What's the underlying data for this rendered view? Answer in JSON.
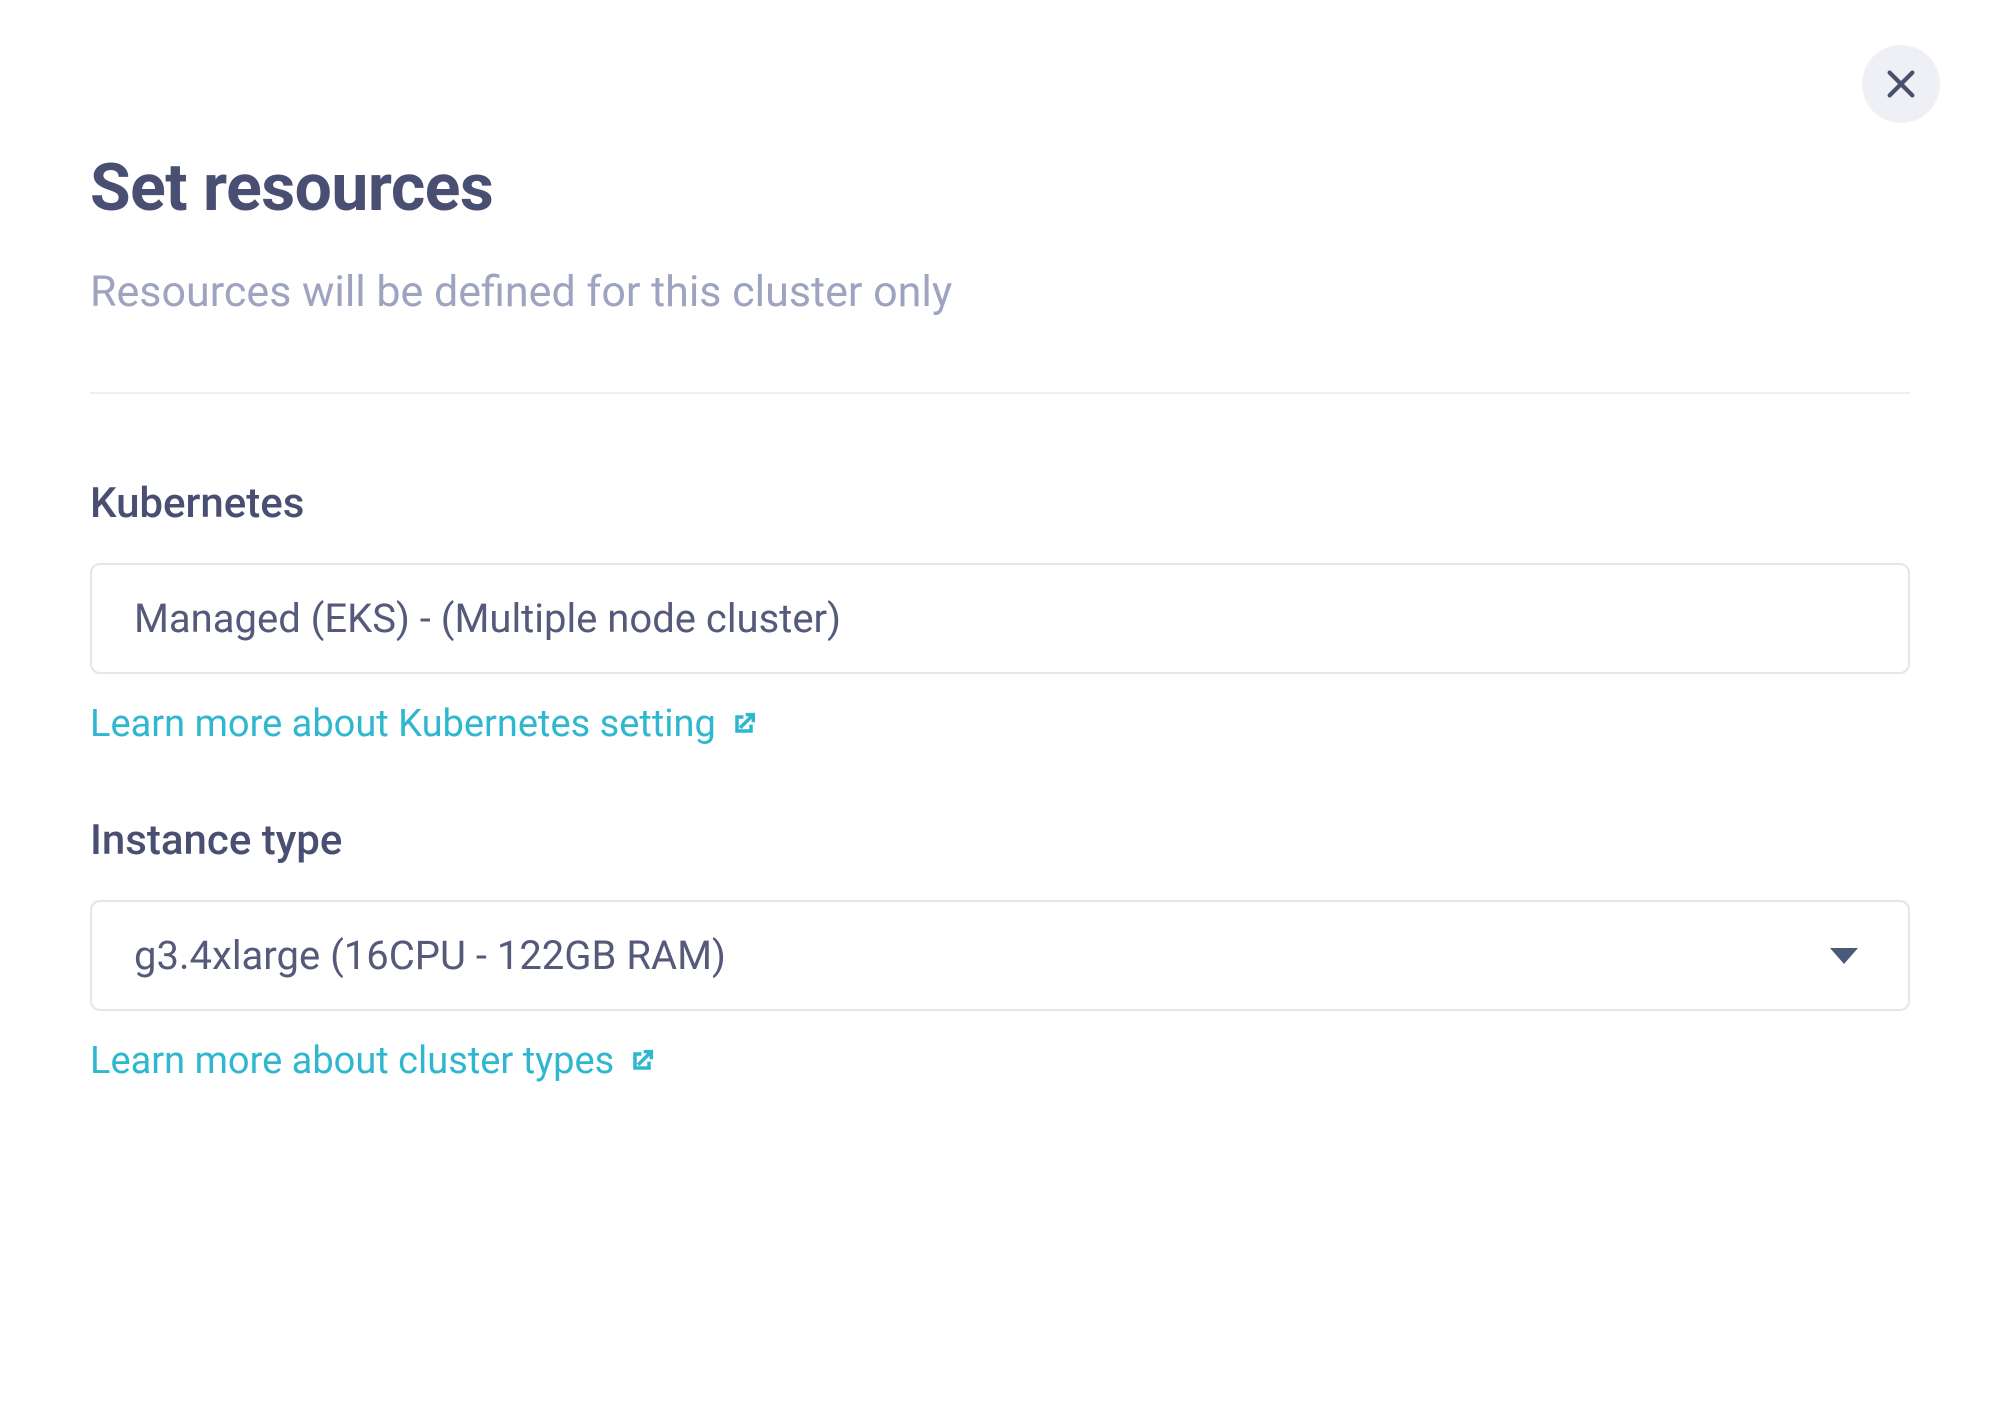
{
  "modal": {
    "title": "Set resources",
    "subtitle": "Resources will be defined for this cluster only"
  },
  "kubernetes": {
    "label": "Kubernetes",
    "value": "Managed (EKS) - (Multiple node cluster)",
    "help_text": "Learn more about Kubernetes setting"
  },
  "instance_type": {
    "label": "Instance type",
    "value": "g3.4xlarge (16CPU - 122GB RAM)",
    "help_text": "Learn more about cluster types"
  }
}
